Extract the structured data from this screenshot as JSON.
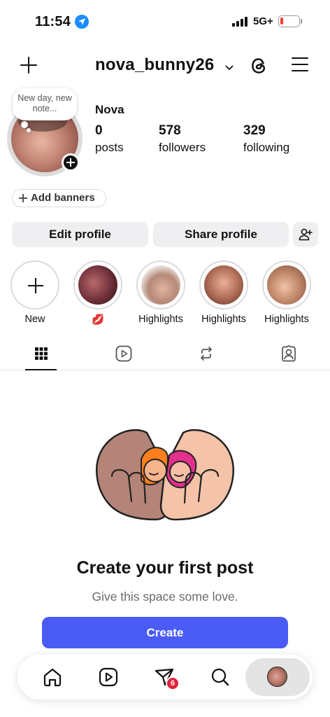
{
  "status_bar": {
    "time": "11:54",
    "network": "5G+",
    "battery_color": "#ff3b30"
  },
  "header": {
    "username": "nova_bunny26"
  },
  "profile": {
    "note": "New day, new note...",
    "display_name": "Nova",
    "stats": [
      {
        "value": "0",
        "label": "posts"
      },
      {
        "value": "578",
        "label": "followers"
      },
      {
        "value": "329",
        "label": "following"
      }
    ],
    "add_banners_label": "Add banners",
    "edit_profile_label": "Edit profile",
    "share_profile_label": "Share profile"
  },
  "highlights": [
    {
      "label": "New"
    },
    {
      "label": "💋"
    },
    {
      "label": "Highlights"
    },
    {
      "label": "Highlights"
    },
    {
      "label": "Highlights"
    }
  ],
  "tabs": [
    {
      "icon": "grid-icon"
    },
    {
      "icon": "reels-icon"
    },
    {
      "icon": "reposts-icon"
    },
    {
      "icon": "tagged-icon"
    }
  ],
  "empty_state": {
    "title": "Create your first post",
    "subtitle": "Give this space some love.",
    "button_label": "Create"
  },
  "bottom_nav": {
    "items": [
      "home-icon",
      "reels-icon",
      "activity-icon",
      "search-icon",
      "profile-avatar"
    ],
    "activity_badge": "6"
  },
  "colors": {
    "accent": "#4a5cf5",
    "badge": "#e0213b",
    "location": "#1a8cff"
  }
}
